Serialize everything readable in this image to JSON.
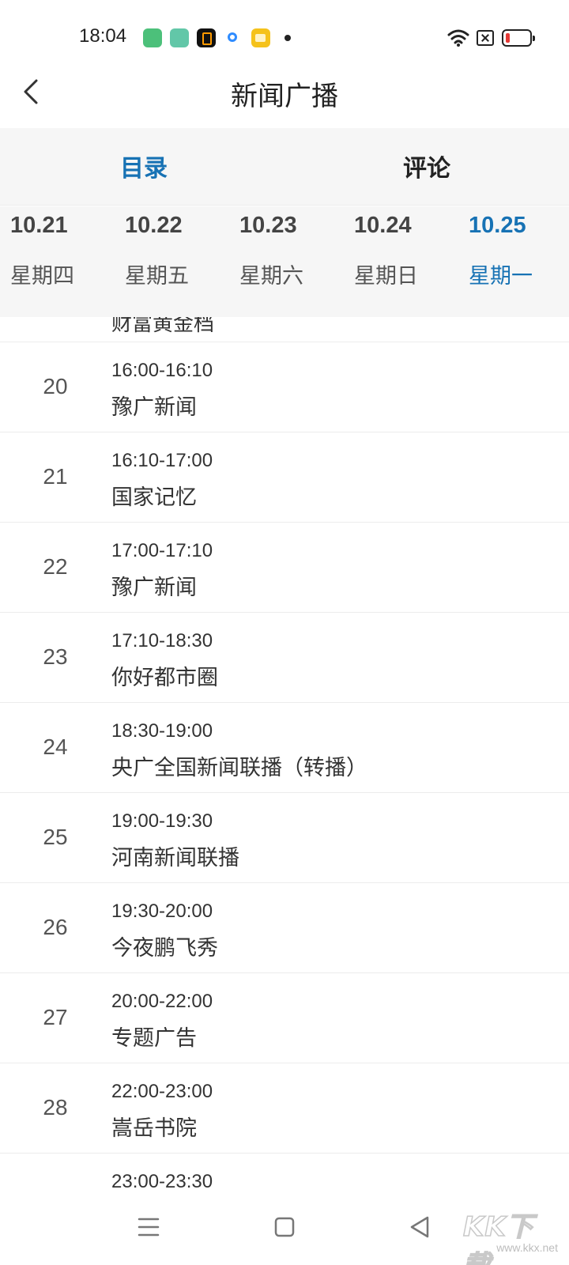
{
  "status_bar": {
    "time": "18:04"
  },
  "header": {
    "title": "新闻广播"
  },
  "tabs": [
    {
      "label": "目录",
      "active": true
    },
    {
      "label": "评论",
      "active": false
    }
  ],
  "dates": [
    {
      "date": "10.21",
      "weekday": "星期四",
      "active": false
    },
    {
      "date": "10.22",
      "weekday": "星期五",
      "active": false
    },
    {
      "date": "10.23",
      "weekday": "星期六",
      "active": false
    },
    {
      "date": "10.24",
      "weekday": "星期日",
      "active": false
    },
    {
      "date": "10.25",
      "weekday": "星期一",
      "active": true
    }
  ],
  "program_list": {
    "partial_top_name": "财富黄金档",
    "items": [
      {
        "number": "20",
        "time": "16:00-16:10",
        "name": "豫广新闻"
      },
      {
        "number": "21",
        "time": "16:10-17:00",
        "name": "国家记忆"
      },
      {
        "number": "22",
        "time": "17:00-17:10",
        "name": "豫广新闻"
      },
      {
        "number": "23",
        "time": "17:10-18:30",
        "name": "你好都市圈"
      },
      {
        "number": "24",
        "time": "18:30-19:00",
        "name": "央广全国新闻联播（转播）"
      },
      {
        "number": "25",
        "time": "19:00-19:30",
        "name": "河南新闻联播"
      },
      {
        "number": "26",
        "time": "19:30-20:00",
        "name": "今夜鹏飞秀"
      },
      {
        "number": "27",
        "time": "20:00-22:00",
        "name": "专题广告"
      },
      {
        "number": "28",
        "time": "22:00-23:00",
        "name": "嵩岳书院"
      }
    ],
    "partial_bottom_time": "23:00-23:30"
  },
  "watermark": {
    "logo": "KK下载",
    "url": "www.kkx.net"
  },
  "colors": {
    "accent": "#1772b4",
    "tab_background": "#f6f6f6",
    "divider": "#ececec",
    "battery_low": "#e53935"
  },
  "icons": {
    "back": "chevron-left-icon",
    "wifi": "wifi-icon",
    "sim": "no-sim-icon",
    "battery": "battery-low-icon",
    "nav_menu": "menu-icon",
    "nav_home": "home-square-icon",
    "nav_back": "back-triangle-icon"
  }
}
